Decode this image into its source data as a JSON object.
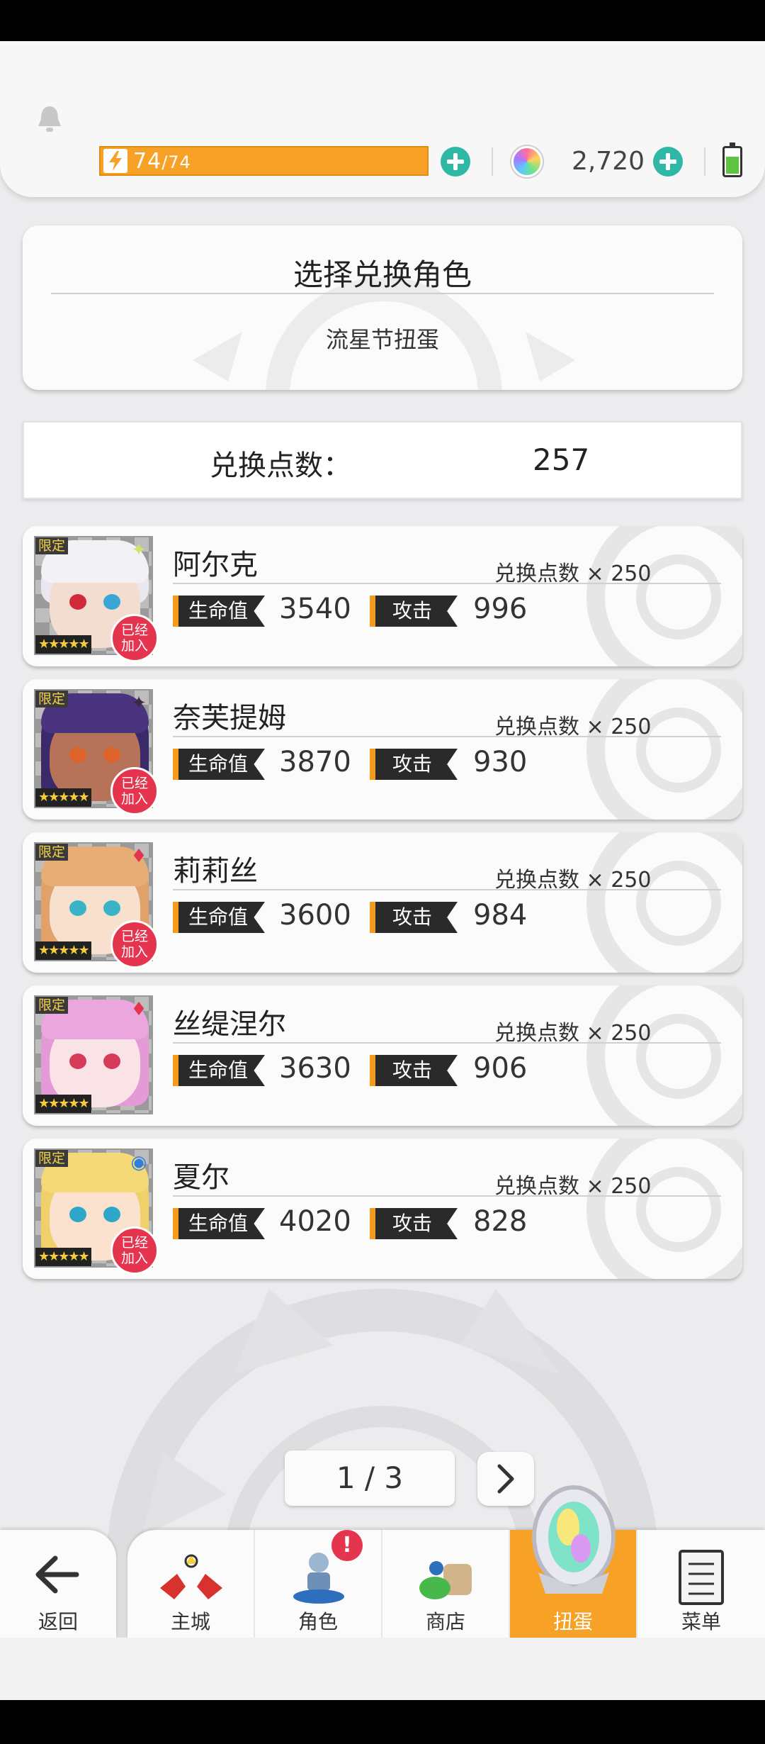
{
  "header": {
    "stamina_current": "74",
    "stamina_max": "/74",
    "gems": "2,720"
  },
  "panel": {
    "title": "选择兑换角色",
    "subtitle": "流星节扭蛋"
  },
  "points": {
    "label": "兑换点数：",
    "value": "257"
  },
  "labels": {
    "hp": "生命值",
    "atk": "攻击",
    "limited": "限定",
    "stars": "★★★★★",
    "joined_1": "已经",
    "joined_2": "加入"
  },
  "characters": [
    {
      "name": "阿尔克",
      "cost": "兑换点数 × 250",
      "hp": "3540",
      "atk": "996",
      "joined": true,
      "element": "light-star-icon",
      "element_color": "#cfe56a"
    },
    {
      "name": "奈芙提姆",
      "cost": "兑换点数 × 250",
      "hp": "3870",
      "atk": "930",
      "joined": true,
      "element": "dark-star-icon",
      "element_color": "#3a2a44"
    },
    {
      "name": "莉莉丝",
      "cost": "兑换点数 × 250",
      "hp": "3600",
      "atk": "984",
      "joined": true,
      "element": "fire-diamond-icon",
      "element_color": "#e5344d"
    },
    {
      "name": "丝缇涅尔",
      "cost": "兑换点数 × 250",
      "hp": "3630",
      "atk": "906",
      "joined": false,
      "element": "fire-diamond-icon",
      "element_color": "#e5344d"
    },
    {
      "name": "夏尔",
      "cost": "兑换点数 × 250",
      "hp": "4020",
      "atk": "828",
      "joined": true,
      "element": "water-circle-icon",
      "element_color": "#2f7fe0"
    }
  ],
  "pager": {
    "text": "1 / 3"
  },
  "nav": {
    "back": "返回",
    "items": [
      "主城",
      "角色",
      "商店",
      "扭蛋",
      "菜单"
    ],
    "active": "扭蛋",
    "badge": "!"
  },
  "colors": {
    "accent": "#f7a127",
    "plus": "#2fb8a6",
    "joined_badge": "#e5344d"
  }
}
